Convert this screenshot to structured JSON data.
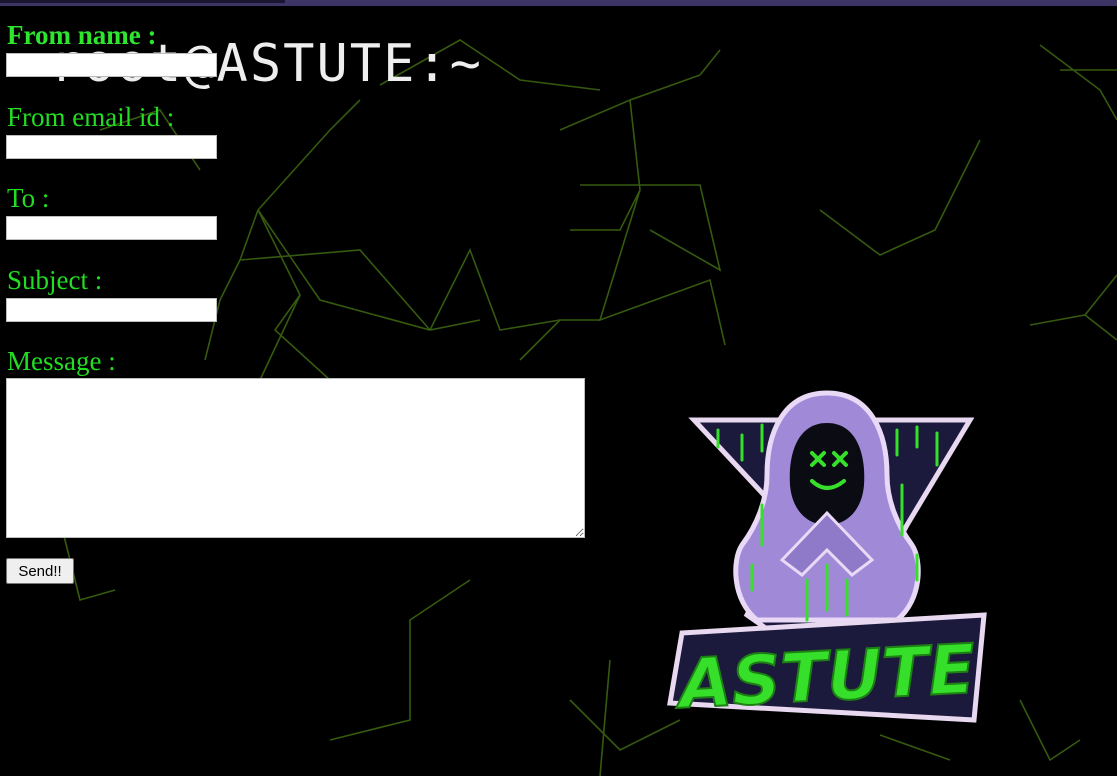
{
  "terminal": {
    "heading": "root@ASTUTE:~"
  },
  "form": {
    "from_name_label": "From name :",
    "from_email_label": "From email id :",
    "to_label": "To :",
    "subject_label": "Subject :",
    "message_label": "Message :",
    "from_name_value": "",
    "from_email_value": "",
    "to_value": "",
    "subject_value": "",
    "message_value": "",
    "send_label": "Send!!"
  },
  "logo": {
    "text": "ASTUTE",
    "icon": "hooded-hacker-logo"
  },
  "colors": {
    "background": "#000000",
    "label_green": "#22dd22",
    "network_lines": "#3f6a12",
    "hood_purple": "#a08ad8",
    "logo_green": "#36e02a",
    "banner_navy": "#1b1a3c",
    "top_bar": "#3d3466"
  }
}
